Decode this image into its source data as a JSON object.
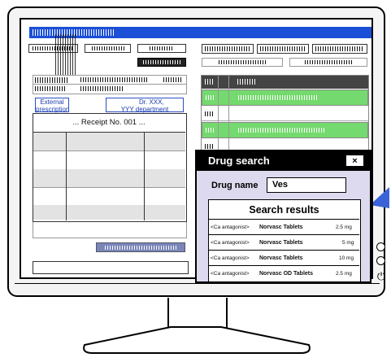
{
  "left_panel": {
    "external_prescription": "External prescription",
    "doctor_line1": "Dr. XXX,",
    "doctor_line2": "YYY department",
    "receipt_title": "... Receipt No. 001 ..."
  },
  "drug_search": {
    "title": "Drug search",
    "close_label": "×",
    "drug_name_label": "Drug name",
    "drug_name_value": "Ves",
    "results_header": "Search results",
    "results": [
      {
        "category": "<Ca antagonist>",
        "name": "Norvasc Tablets",
        "dose": "2.5 mg"
      },
      {
        "category": "<Ca antagonist>",
        "name": "Norvasc Tablets",
        "dose": "5 mg"
      },
      {
        "category": "<Ca antagonist>",
        "name": "Norvasc Tablets",
        "dose": "10 mg"
      },
      {
        "category": "<Ca antagonist>",
        "name": "Norvasc OD Tablets",
        "dose": "2.5 mg"
      }
    ]
  },
  "colors": {
    "title_bar": "#1b4fd6",
    "selected_row": "#74d96e",
    "dialog_bg": "#ddd9ee"
  }
}
